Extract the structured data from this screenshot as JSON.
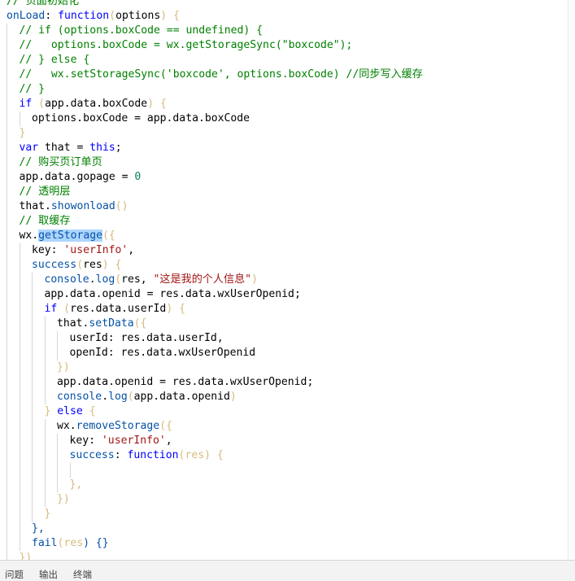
{
  "colors": {
    "comment": "#008000",
    "keyword": "#0000ff",
    "string": "#a31515",
    "property": "#0451a5",
    "method": "#795e26",
    "plain": "#000000",
    "paren": "#d7ba7d",
    "number": "#098658",
    "selection": "#add6ff"
  },
  "code": {
    "lines": [
      {
        "indent": 1,
        "tokens": [
          {
            "t": "// 页面初始化",
            "c": "comment"
          }
        ]
      },
      {
        "indent": 1,
        "tokens": [
          {
            "t": "onLoad",
            "c": "property"
          },
          {
            "t": ": ",
            "c": "plain"
          },
          {
            "t": "function",
            "c": "keyword"
          },
          {
            "t": "(",
            "c": "paren"
          },
          {
            "t": "options",
            "c": "plain"
          },
          {
            "t": ") {",
            "c": "paren"
          }
        ]
      },
      {
        "indent": 2,
        "tokens": [
          {
            "t": "// if (options.boxCode == undefined) {",
            "c": "comment"
          }
        ]
      },
      {
        "indent": 2,
        "tokens": [
          {
            "t": "//   options.boxCode = wx.getStorageSync(\"boxcode\");",
            "c": "comment"
          }
        ]
      },
      {
        "indent": 2,
        "tokens": [
          {
            "t": "// } else {",
            "c": "comment"
          }
        ]
      },
      {
        "indent": 2,
        "tokens": [
          {
            "t": "//   wx.setStorageSync('boxcode', options.boxCode) //同步写入缓存",
            "c": "comment"
          }
        ]
      },
      {
        "indent": 2,
        "tokens": [
          {
            "t": "// }",
            "c": "comment"
          }
        ]
      },
      {
        "indent": 2,
        "tokens": [
          {
            "t": "if",
            "c": "keyword"
          },
          {
            "t": " (",
            "c": "paren"
          },
          {
            "t": "app.data.boxCode",
            "c": "plain"
          },
          {
            "t": ") {",
            "c": "paren"
          }
        ]
      },
      {
        "indent": 3,
        "tokens": [
          {
            "t": "options.boxCode = app.data.boxCode",
            "c": "plain"
          }
        ]
      },
      {
        "indent": 2,
        "tokens": [
          {
            "t": "}",
            "c": "paren"
          }
        ]
      },
      {
        "indent": 2,
        "tokens": [
          {
            "t": "var",
            "c": "keyword"
          },
          {
            "t": " that = ",
            "c": "plain"
          },
          {
            "t": "this",
            "c": "keyword"
          },
          {
            "t": ";",
            "c": "plain"
          }
        ]
      },
      {
        "indent": 2,
        "tokens": [
          {
            "t": "// 购买页订单页",
            "c": "comment"
          }
        ]
      },
      {
        "indent": 2,
        "tokens": [
          {
            "t": "app.data.gopage = ",
            "c": "plain"
          },
          {
            "t": "0",
            "c": "number"
          }
        ]
      },
      {
        "indent": 2,
        "tokens": [
          {
            "t": "// 透明层",
            "c": "comment"
          }
        ]
      },
      {
        "indent": 2,
        "tokens": [
          {
            "t": "that.",
            "c": "plain"
          },
          {
            "t": "showonload",
            "c": "property"
          },
          {
            "t": "()",
            "c": "paren"
          }
        ]
      },
      {
        "indent": 2,
        "tokens": [
          {
            "t": "// 取缓存",
            "c": "comment"
          }
        ]
      },
      {
        "indent": 2,
        "tokens": [
          {
            "t": "wx.",
            "c": "plain"
          },
          {
            "t": "getStorage",
            "c": "property",
            "sel": true
          },
          {
            "t": "({",
            "c": "paren"
          }
        ]
      },
      {
        "indent": 3,
        "tokens": [
          {
            "t": "key: ",
            "c": "plain"
          },
          {
            "t": "'userInfo'",
            "c": "string"
          },
          {
            "t": ",",
            "c": "plain"
          }
        ]
      },
      {
        "indent": 3,
        "tokens": [
          {
            "t": "success",
            "c": "property"
          },
          {
            "t": "(",
            "c": "paren"
          },
          {
            "t": "res",
            "c": "plain"
          },
          {
            "t": ") {",
            "c": "paren"
          }
        ]
      },
      {
        "indent": 4,
        "tokens": [
          {
            "t": "console",
            "c": "property"
          },
          {
            "t": ".",
            "c": "plain"
          },
          {
            "t": "log",
            "c": "property"
          },
          {
            "t": "(",
            "c": "paren"
          },
          {
            "t": "res, ",
            "c": "plain"
          },
          {
            "t": "\"这是我的个人信息\"",
            "c": "string"
          },
          {
            "t": ")",
            "c": "paren"
          }
        ]
      },
      {
        "indent": 4,
        "tokens": [
          {
            "t": "app.data.openid = res.data.wxUserOpenid;",
            "c": "plain"
          }
        ]
      },
      {
        "indent": 4,
        "tokens": [
          {
            "t": "if",
            "c": "keyword"
          },
          {
            "t": " (",
            "c": "paren"
          },
          {
            "t": "res.data.userId",
            "c": "plain"
          },
          {
            "t": ") {",
            "c": "paren"
          }
        ]
      },
      {
        "indent": 5,
        "tokens": [
          {
            "t": "that.",
            "c": "plain"
          },
          {
            "t": "setData",
            "c": "property"
          },
          {
            "t": "({",
            "c": "paren"
          }
        ]
      },
      {
        "indent": 6,
        "tokens": [
          {
            "t": "userId: res.data.userId,",
            "c": "plain"
          }
        ]
      },
      {
        "indent": 6,
        "tokens": [
          {
            "t": "openId: res.data.wxUserOpenid",
            "c": "plain"
          }
        ]
      },
      {
        "indent": 5,
        "tokens": [
          {
            "t": "})",
            "c": "paren"
          }
        ]
      },
      {
        "indent": 5,
        "tokens": [
          {
            "t": "app.data.openid = res.data.wxUserOpenid;",
            "c": "plain"
          }
        ]
      },
      {
        "indent": 5,
        "tokens": [
          {
            "t": "console",
            "c": "property"
          },
          {
            "t": ".",
            "c": "plain"
          },
          {
            "t": "log",
            "c": "property"
          },
          {
            "t": "(",
            "c": "paren"
          },
          {
            "t": "app.data.openid",
            "c": "plain"
          },
          {
            "t": ")",
            "c": "paren"
          }
        ]
      },
      {
        "indent": 4,
        "tokens": [
          {
            "t": "}",
            "c": "paren"
          },
          {
            "t": " else ",
            "c": "keyword"
          },
          {
            "t": "{",
            "c": "paren"
          }
        ]
      },
      {
        "indent": 5,
        "tokens": [
          {
            "t": "wx.",
            "c": "plain"
          },
          {
            "t": "removeStorage",
            "c": "property"
          },
          {
            "t": "({",
            "c": "paren"
          }
        ]
      },
      {
        "indent": 6,
        "tokens": [
          {
            "t": "key: ",
            "c": "plain"
          },
          {
            "t": "'userInfo'",
            "c": "string"
          },
          {
            "t": ",",
            "c": "plain"
          }
        ]
      },
      {
        "indent": 6,
        "tokens": [
          {
            "t": "success",
            "c": "property"
          },
          {
            "t": ": ",
            "c": "plain"
          },
          {
            "t": "function",
            "c": "keyword"
          },
          {
            "t": "(",
            "c": "paren"
          },
          {
            "t": "res",
            "c": "paren"
          },
          {
            "t": ") {",
            "c": "paren"
          }
        ]
      },
      {
        "indent": 7,
        "tokens": []
      },
      {
        "indent": 6,
        "tokens": [
          {
            "t": "},",
            "c": "paren"
          }
        ]
      },
      {
        "indent": 5,
        "tokens": [
          {
            "t": "})",
            "c": "paren"
          }
        ]
      },
      {
        "indent": 4,
        "tokens": [
          {
            "t": "}",
            "c": "paren"
          }
        ]
      },
      {
        "indent": 3,
        "tokens": [
          {
            "t": "},",
            "c": "property"
          }
        ]
      },
      {
        "indent": 3,
        "tokens": [
          {
            "t": "fail",
            "c": "property"
          },
          {
            "t": "(",
            "c": "paren"
          },
          {
            "t": "res",
            "c": "paren"
          },
          {
            "t": ") {}",
            "c": "property"
          }
        ]
      },
      {
        "indent": 2,
        "tokens": [
          {
            "t": "})",
            "c": "paren"
          }
        ]
      }
    ]
  },
  "panel": {
    "tabs": [
      {
        "label": "问题"
      },
      {
        "label": "输出"
      },
      {
        "label": "终端"
      }
    ]
  }
}
